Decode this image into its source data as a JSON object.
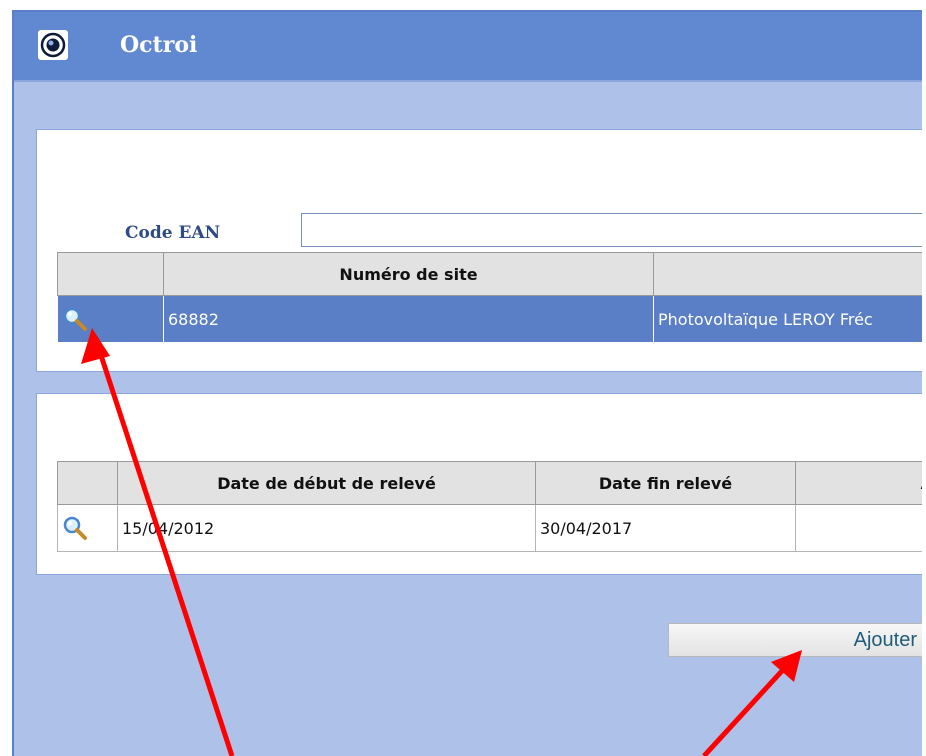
{
  "window": {
    "title": "Octroi"
  },
  "search": {
    "label": "Code EAN",
    "value": "",
    "placeholder": ""
  },
  "sites_table": {
    "headers": [
      "",
      "Numéro de site",
      ""
    ],
    "rows": [
      {
        "site_number": "68882",
        "description": "Photovoltaïque LEROY Fréc"
      }
    ]
  },
  "readings_table": {
    "headers": [
      "",
      "Date de début de relevé",
      "Date fin relevé",
      "A"
    ],
    "rows": [
      {
        "start_date": "15/04/2012",
        "end_date": "30/04/2017",
        "extra": ""
      }
    ]
  },
  "actions": {
    "add_label": "Ajouter"
  },
  "icons": {
    "app": "app-logo-icon",
    "row_detail": "magnifier-icon"
  },
  "colors": {
    "titlebar": "#6189d2",
    "window_bg": "#aec2e9",
    "selected_row": "#5b7fc6",
    "annotation_arrow": "#ff0000"
  }
}
